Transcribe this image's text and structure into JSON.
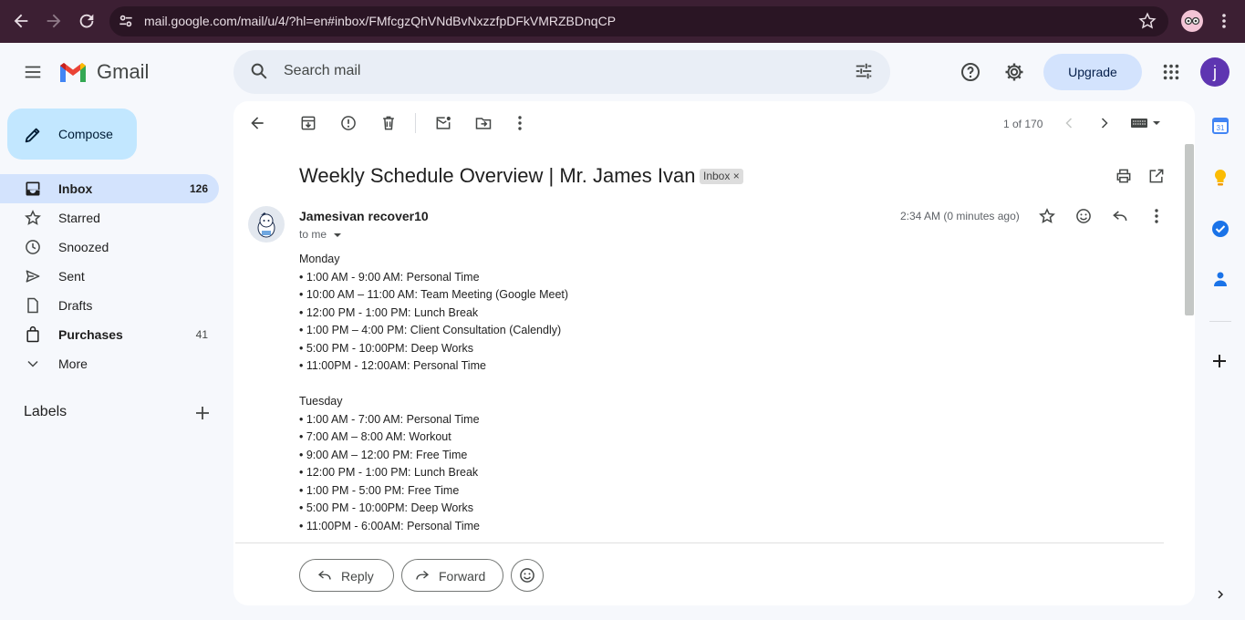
{
  "browser": {
    "url": "mail.google.com/mail/u/4/?hl=en#inbox/FMfcgzQhVNdBvNxzzfpDFkVMRZBDnqCP"
  },
  "app": {
    "name": "Gmail",
    "search_placeholder": "Search mail",
    "upgrade_label": "Upgrade",
    "avatar_letter": "j"
  },
  "sidebar": {
    "compose_label": "Compose",
    "items": [
      {
        "label": "Inbox",
        "count": "126",
        "icon": "inbox-icon"
      },
      {
        "label": "Starred",
        "count": "",
        "icon": "star-icon"
      },
      {
        "label": "Snoozed",
        "count": "",
        "icon": "clock-icon"
      },
      {
        "label": "Sent",
        "count": "",
        "icon": "send-icon"
      },
      {
        "label": "Drafts",
        "count": "",
        "icon": "draft-icon"
      },
      {
        "label": "Purchases",
        "count": "41",
        "icon": "purchases-icon"
      },
      {
        "label": "More",
        "count": "",
        "icon": "chevron-down-icon"
      }
    ],
    "labels_heading": "Labels"
  },
  "toolbar": {
    "pager": "1 of 170"
  },
  "email": {
    "subject": "Weekly Schedule Overview | Mr. James Ivan",
    "label_chip": "Inbox",
    "label_chip_close": "×",
    "sender": "Jamesivan recover10",
    "to": "to me",
    "time": "2:34 AM (0 minutes ago)",
    "body_lines": [
      " Monday",
      "• 1:00 AM - 9:00 AM: Personal Time",
      "• 10:00 AM – 11:00 AM: Team Meeting (Google Meet)",
      "• 12:00 PM - 1:00 PM: Lunch Break",
      "• 1:00 PM – 4:00 PM: Client Consultation (Calendly)",
      "• 5:00 PM - 10:00PM: Deep Works",
      "• 11:00PM - 12:00AM: Personal Time",
      "",
      "  Tuesday",
      "• 1:00 AM - 7:00 AM: Personal Time",
      "• 7:00 AM – 8:00 AM: Workout",
      "• 9:00 AM – 12:00 PM: Free Time",
      "• 12:00 PM - 1:00 PM: Lunch Break",
      "• 1:00 PM - 5:00 PM: Free Time",
      "• 5:00 PM - 10:00PM: Deep Works",
      "• 11:00PM - 6:00AM: Personal Time"
    ],
    "reply_label": "Reply",
    "forward_label": "Forward"
  },
  "colors": {
    "browser_bar": "#3c1f33",
    "active_nav": "#d3e3fd",
    "compose": "#c2e7ff",
    "avatar": "#5e35b1"
  }
}
